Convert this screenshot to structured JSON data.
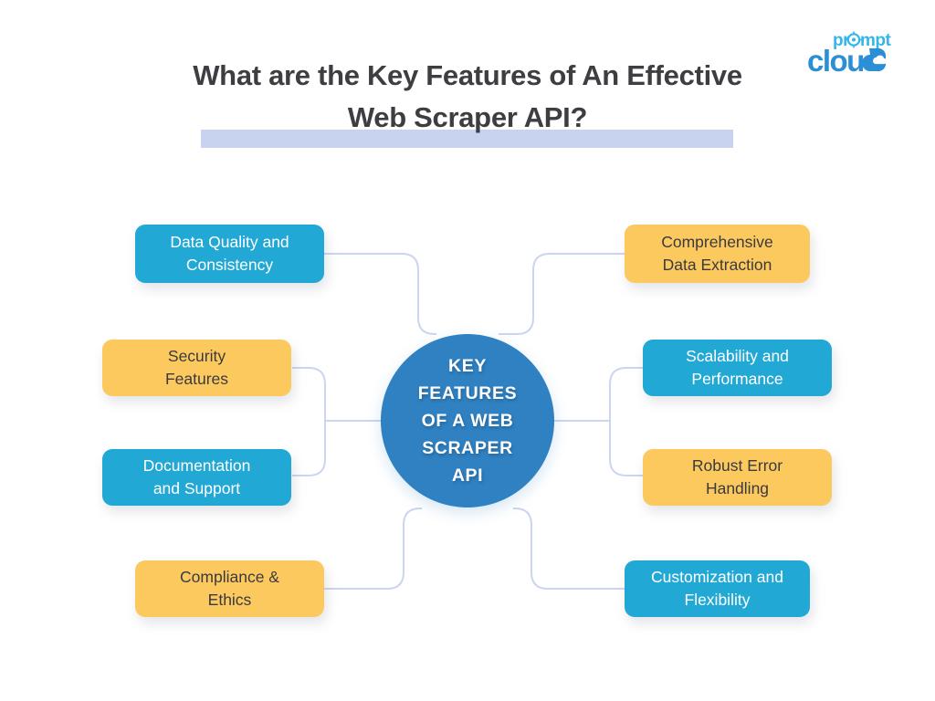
{
  "brand": {
    "logo_top_text": "prompt",
    "logo_bottom_text": "cloud",
    "logo_color_top": "#35b6e8",
    "logo_color_bottom": "#2b8fd6"
  },
  "header": {
    "title": "What are the Key Features of An Effective Web Scraper API?",
    "highlight_color": "#c7d3ef",
    "title_color": "#3d3d42"
  },
  "center": {
    "label": "KEY\nFEATURES\nOF A WEB\nSCRAPER\nAPI",
    "color": "#2f81c2",
    "text_color": "#ffffff"
  },
  "palette": {
    "blue": "#22a8d4",
    "yellow": "#fcc95f",
    "connector": "#ccd5f0",
    "background": "#ffffff"
  },
  "features": {
    "left": [
      {
        "label": "Data Quality and\nConsistency",
        "color": "blue"
      },
      {
        "label": "Security\nFeatures",
        "color": "yellow"
      },
      {
        "label": "Documentation\nand Support",
        "color": "blue"
      },
      {
        "label": "Compliance &\nEthics",
        "color": "yellow"
      }
    ],
    "right": [
      {
        "label": "Comprehensive\nData Extraction",
        "color": "yellow"
      },
      {
        "label": "Scalability and\nPerformance",
        "color": "blue"
      },
      {
        "label": "Robust Error\nHandling",
        "color": "yellow"
      },
      {
        "label": "Customization and\nFlexibility",
        "color": "blue"
      }
    ]
  }
}
